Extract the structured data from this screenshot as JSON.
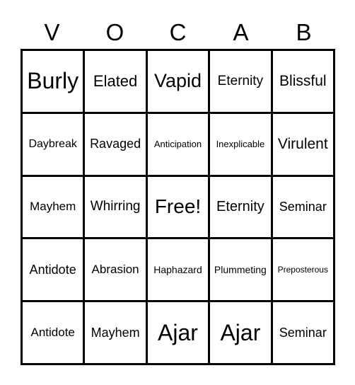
{
  "header": [
    "V",
    "O",
    "C",
    "A",
    "B"
  ],
  "cells": [
    [
      "Burly",
      "Elated",
      "Vapid",
      "Eternity",
      "Blissful"
    ],
    [
      "Daybreak",
      "Ravaged",
      "Anticipation",
      "Inexplicable",
      "Virulent"
    ],
    [
      "Mayhem",
      "Whirring",
      "Free!",
      "Eternity",
      "Seminar"
    ],
    [
      "Antidote",
      "Abrasion",
      "Haphazard",
      "Plummeting",
      "Preposterous"
    ],
    [
      "Antidote",
      "Mayhem",
      "Ajar",
      "Ajar",
      "Seminar"
    ]
  ],
  "free_space": "Free!"
}
